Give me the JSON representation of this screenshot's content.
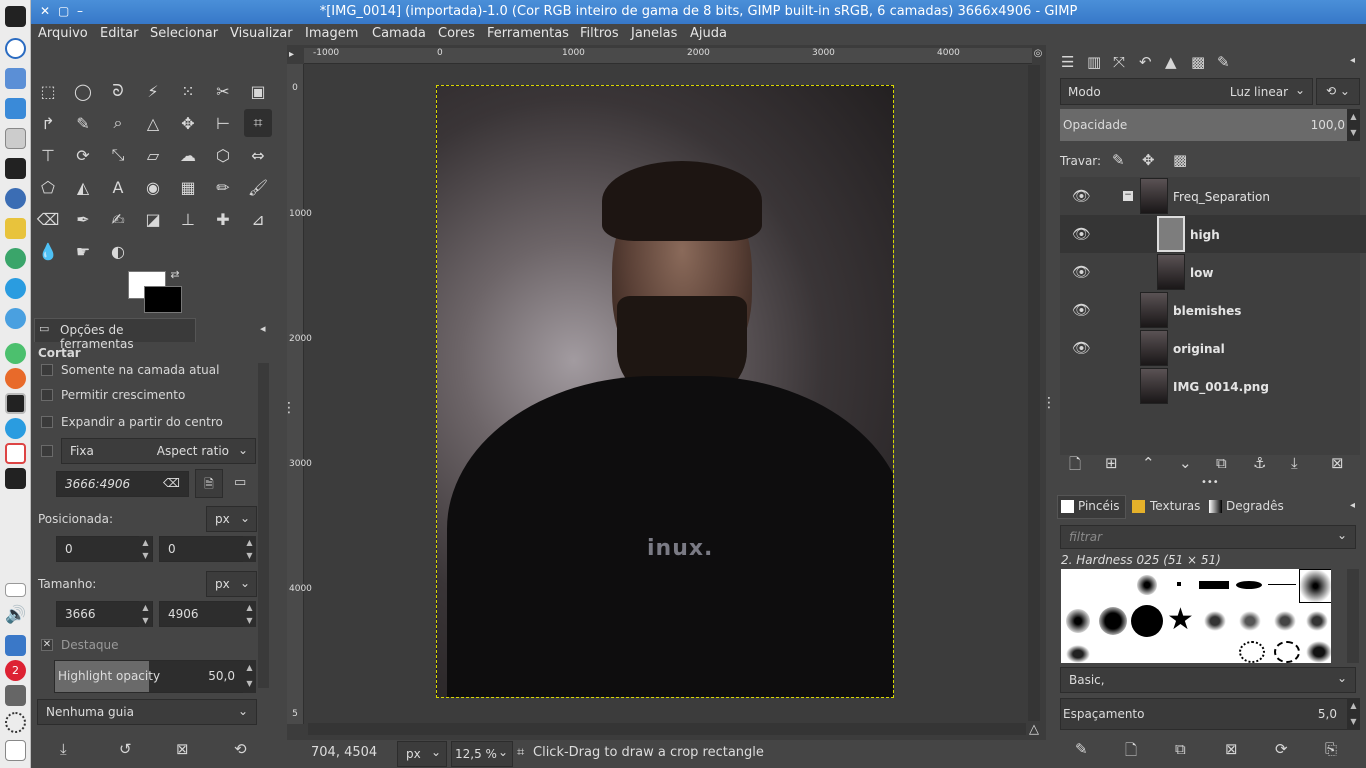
{
  "window": {
    "title": "*[IMG_0014] (importada)-1.0 (Cor RGB inteiro de gama de 8 bits, GIMP built-in sRGB, 6 camadas) 3666x4906 - GIMP"
  },
  "menu": [
    "Arquivo",
    "Editar",
    "Selecionar",
    "Visualizar",
    "Imagem",
    "Camada",
    "Cores",
    "Ferramentas",
    "Filtros",
    "Janelas",
    "Ajuda"
  ],
  "tool_options": {
    "tab": "Opções de ferramentas",
    "tool": "Cortar",
    "only_current_layer": "Somente na camada atual",
    "allow_growing": "Permitir crescimento",
    "expand_center": "Expandir a partir do centro",
    "fixed": "Fixa",
    "aspect": "Aspect ratio",
    "aspect_value": "3666:4906",
    "position_label": "Posicionada:",
    "unit": "px",
    "pos_x": "0",
    "pos_y": "0",
    "size_label": "Tamanho:",
    "size_w": "3666",
    "size_h": "4906",
    "highlight": "Destaque",
    "highlight_opacity_label": "Highlight opacity",
    "highlight_opacity": "50,0",
    "guides": "Nenhuma guia"
  },
  "ruler": {
    "h": [
      "-1000",
      "0",
      "1000",
      "2000",
      "3000",
      "4000"
    ],
    "v": [
      "0",
      "1000",
      "2000",
      "3000",
      "4000",
      "5"
    ]
  },
  "image_text": "inux.",
  "status": {
    "coords": "704, 4504",
    "unit": "px",
    "zoom": "12,5 %",
    "message": "Click-Drag to draw a crop rectangle"
  },
  "layers": {
    "mode_label": "Modo",
    "mode": "Luz linear",
    "opacity_label": "Opacidade",
    "opacity": "100,0",
    "lock_label": "Travar:",
    "items": [
      {
        "name": "Freq_Separation"
      },
      {
        "name": "high"
      },
      {
        "name": "low"
      },
      {
        "name": "blemishes"
      },
      {
        "name": "original"
      },
      {
        "name": "IMG_0014.png"
      }
    ]
  },
  "brushes": {
    "tabs": [
      "Pincéis",
      "Texturas",
      "Degradês"
    ],
    "filter_placeholder": "filtrar",
    "current": "2. Hardness 025 (51 × 51)",
    "set": "Basic,",
    "spacing_label": "Espaçamento",
    "spacing": "5,0"
  },
  "taskbar": {
    "badge": "2"
  }
}
